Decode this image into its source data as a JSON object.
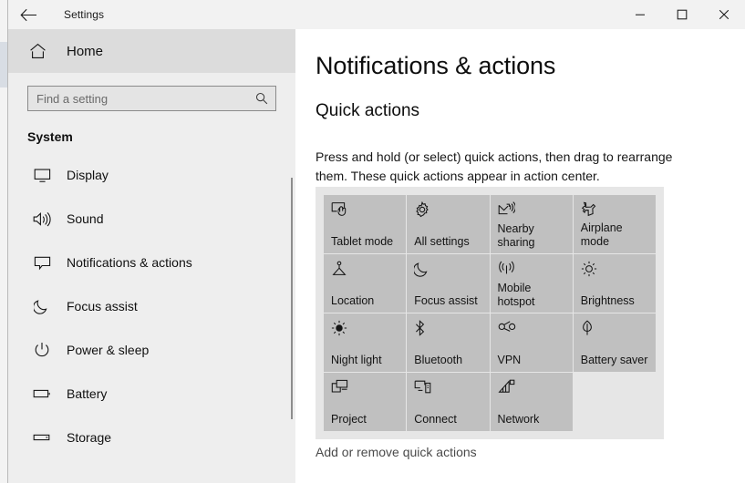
{
  "titlebar": {
    "back_icon": "back-arrow-icon",
    "title": "Settings",
    "minimize_icon": "minimize-icon",
    "maximize_icon": "maximize-icon",
    "close_icon": "close-icon"
  },
  "sidebar": {
    "home": {
      "label": "Home",
      "icon": "home-icon"
    },
    "search": {
      "value": "",
      "placeholder": "Find a setting",
      "icon": "search-icon"
    },
    "group_title": "System",
    "items": [
      {
        "label": "Display",
        "icon": "monitor-icon"
      },
      {
        "label": "Sound",
        "icon": "speaker-icon"
      },
      {
        "label": "Notifications & actions",
        "icon": "notification-balloon-icon"
      },
      {
        "label": "Focus assist",
        "icon": "moon-icon"
      },
      {
        "label": "Power & sleep",
        "icon": "power-icon"
      },
      {
        "label": "Battery",
        "icon": "battery-icon"
      },
      {
        "label": "Storage",
        "icon": "storage-icon"
      }
    ]
  },
  "main": {
    "page_title": "Notifications & actions",
    "section_title": "Quick actions",
    "section_desc": "Press and hold (or select) quick actions, then drag to rearrange them. These quick actions appear in action center.",
    "tiles": [
      {
        "label": "Tablet mode",
        "icon": "tablet-mode-icon"
      },
      {
        "label": "All settings",
        "icon": "gear-icon"
      },
      {
        "label": "Nearby sharing",
        "icon": "nearby-sharing-icon"
      },
      {
        "label": "Airplane mode",
        "icon": "airplane-icon"
      },
      {
        "label": "Location",
        "icon": "location-icon"
      },
      {
        "label": "Focus assist",
        "icon": "moon-icon"
      },
      {
        "label": "Mobile hotspot",
        "icon": "hotspot-icon"
      },
      {
        "label": "Brightness",
        "icon": "brightness-icon"
      },
      {
        "label": "Night light",
        "icon": "night-light-icon"
      },
      {
        "label": "Bluetooth",
        "icon": "bluetooth-icon"
      },
      {
        "label": "VPN",
        "icon": "vpn-icon"
      },
      {
        "label": "Battery saver",
        "icon": "battery-saver-leaf-icon"
      },
      {
        "label": "Project",
        "icon": "project-icon"
      },
      {
        "label": "Connect",
        "icon": "connect-icon"
      },
      {
        "label": "Network",
        "icon": "network-wifi-icon"
      }
    ],
    "add_remove_link": "Add or remove quick actions"
  },
  "colors": {
    "sidebar_bg": "#eeeeee",
    "home_row_bg": "#dcdcdc",
    "titlebar_bg": "#f2f2f2",
    "grid_bg": "#e6e6e6",
    "tile_bg": "#c0c0c0",
    "content_bg": "#ffffff",
    "text": "#101010",
    "link_text": "#4a4a4a"
  }
}
